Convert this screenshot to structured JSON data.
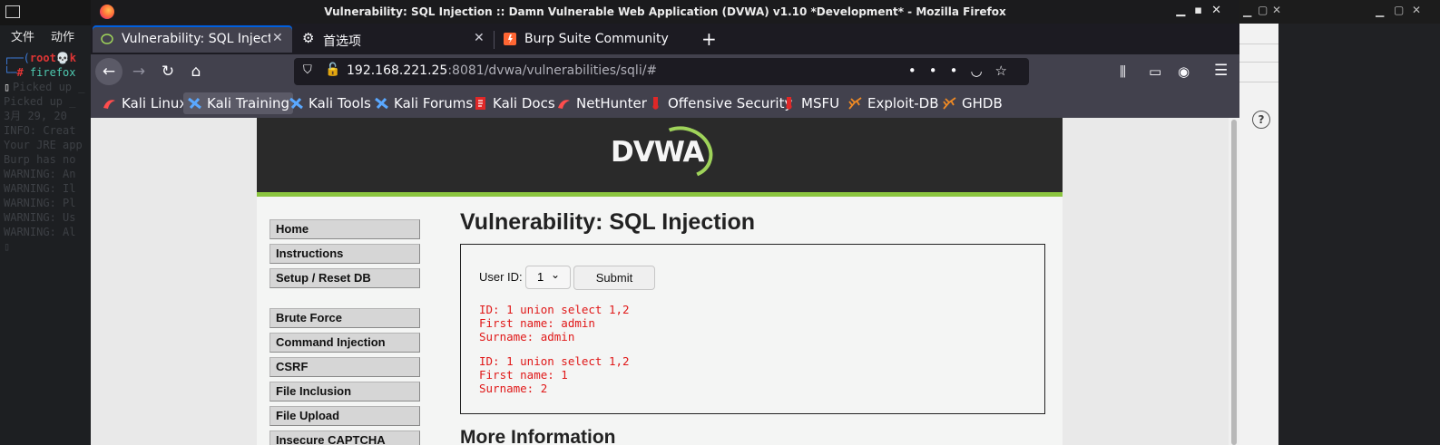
{
  "terminal": {
    "menu": [
      "文件",
      "动作"
    ],
    "prompt_user": "root",
    "prompt_host_fragment": "k",
    "command": "firefox",
    "faint_lines": [
      "Picked up _",
      "Picked up _",
      "3月 29, 20",
      "INFO: Creat",
      "Your JRE app",
      "Burp has no",
      "WARNING: An",
      "WARNING: Il",
      "WARNING: Pl",
      "WARNING: Us",
      "WARNING: Al"
    ]
  },
  "window": {
    "title": "Vulnerability: SQL Injection :: Damn Vulnerable Web Application (DVWA) v1.10 *Development* - Mozilla Firefox"
  },
  "tabs": [
    {
      "label": "Vulnerability: SQL Injecti",
      "active": true
    },
    {
      "label": "首选项",
      "active": false
    },
    {
      "label": "Burp Suite Community Ed",
      "active": false
    }
  ],
  "url": {
    "host": "192.168.221.25",
    "rest": ":8081/dvwa/vulnerabilities/sqli/#"
  },
  "bookmarks": [
    {
      "label": "Kali Linux",
      "icon": "kali-dragon-icon"
    },
    {
      "label": "Kali Training",
      "icon": "kali-training-icon"
    },
    {
      "label": "Kali Tools",
      "icon": "kali-tools-icon"
    },
    {
      "label": "Kali Forums",
      "icon": "kali-forums-icon"
    },
    {
      "label": "Kali Docs",
      "icon": "kali-docs-icon"
    },
    {
      "label": "NetHunter",
      "icon": "nethunter-icon"
    },
    {
      "label": "Offensive Security",
      "icon": "offsec-icon"
    },
    {
      "label": "MSFU",
      "icon": "msfu-icon"
    },
    {
      "label": "Exploit-DB",
      "icon": "exploitdb-icon"
    },
    {
      "label": "GHDB",
      "icon": "ghdb-icon"
    }
  ],
  "dvwa": {
    "logo": "DVWA",
    "menu_group1": [
      "Home",
      "Instructions",
      "Setup / Reset DB"
    ],
    "menu_group2": [
      "Brute Force",
      "Command Injection",
      "CSRF",
      "File Inclusion",
      "File Upload",
      "Insecure CAPTCHA"
    ],
    "heading": "Vulnerability: SQL Injection",
    "user_id_label": "User ID:",
    "user_id_value": "1",
    "submit_label": "Submit",
    "results": [
      {
        "id": "ID: 1 union select 1,2",
        "first": "First name: admin",
        "surname": "Surname: admin"
      },
      {
        "id": "ID: 1 union select 1,2",
        "first": "First name: 1",
        "surname": "Surname: 2"
      }
    ],
    "more_info": "More Information"
  },
  "colors": {
    "accent_green": "#8bc53f",
    "result_red": "#e01818",
    "firefox_toolbar": "#42414d"
  }
}
